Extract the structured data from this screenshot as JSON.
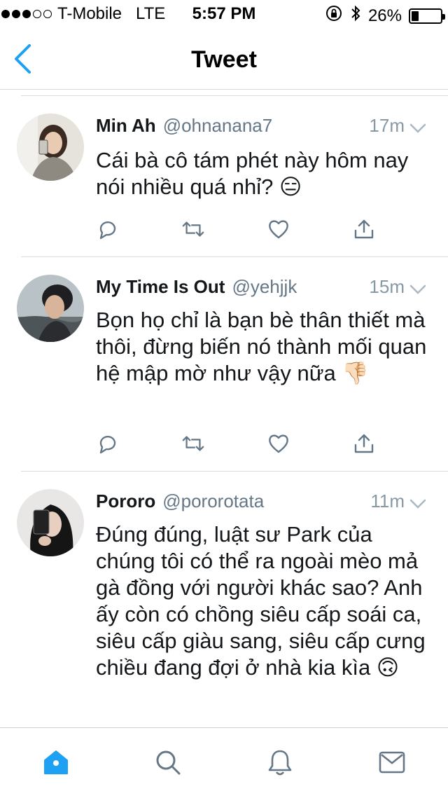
{
  "status_bar": {
    "carrier": "T-Mobile",
    "network": "LTE",
    "time": "5:57 PM",
    "battery_percent": "26%",
    "battery_level": 0.26,
    "signal_bars_filled": 3,
    "signal_bars_total": 5
  },
  "nav": {
    "title": "Tweet"
  },
  "colors": {
    "accent": "#1da1f2",
    "icon_gray": "#657786",
    "text": "#14171a"
  },
  "tweets": [
    {
      "name": "Min Ah",
      "handle": "@ohnanana7",
      "time": "17m",
      "text": "Cái bà cô tám phét này hôm nay nói nhiều quá nhỉ? 😑"
    },
    {
      "name": "My Time Is Out",
      "handle": "@yehjjk",
      "time": "15m",
      "text": "Bọn họ chỉ là bạn bè thân thiết mà thôi, đừng biến nó thành mối quan hệ mập mờ như vậy nữa 👎🏻"
    },
    {
      "name": "Pororo",
      "handle": "@pororotata",
      "time": "11m",
      "text": "Đúng đúng, luật sư Park của chúng tôi có thể ra ngoài mèo mả gà đồng với người khác sao? Anh ấy còn có chồng siêu cấp soái ca, siêu cấp giàu sang, siêu cấp cưng chiều đang đợi ở nhà kia kìa 🙃"
    }
  ],
  "tab_bar": {
    "items": [
      {
        "icon": "home-icon",
        "active": true
      },
      {
        "icon": "search-icon",
        "active": false
      },
      {
        "icon": "bell-icon",
        "active": false
      },
      {
        "icon": "mail-icon",
        "active": false
      }
    ]
  }
}
